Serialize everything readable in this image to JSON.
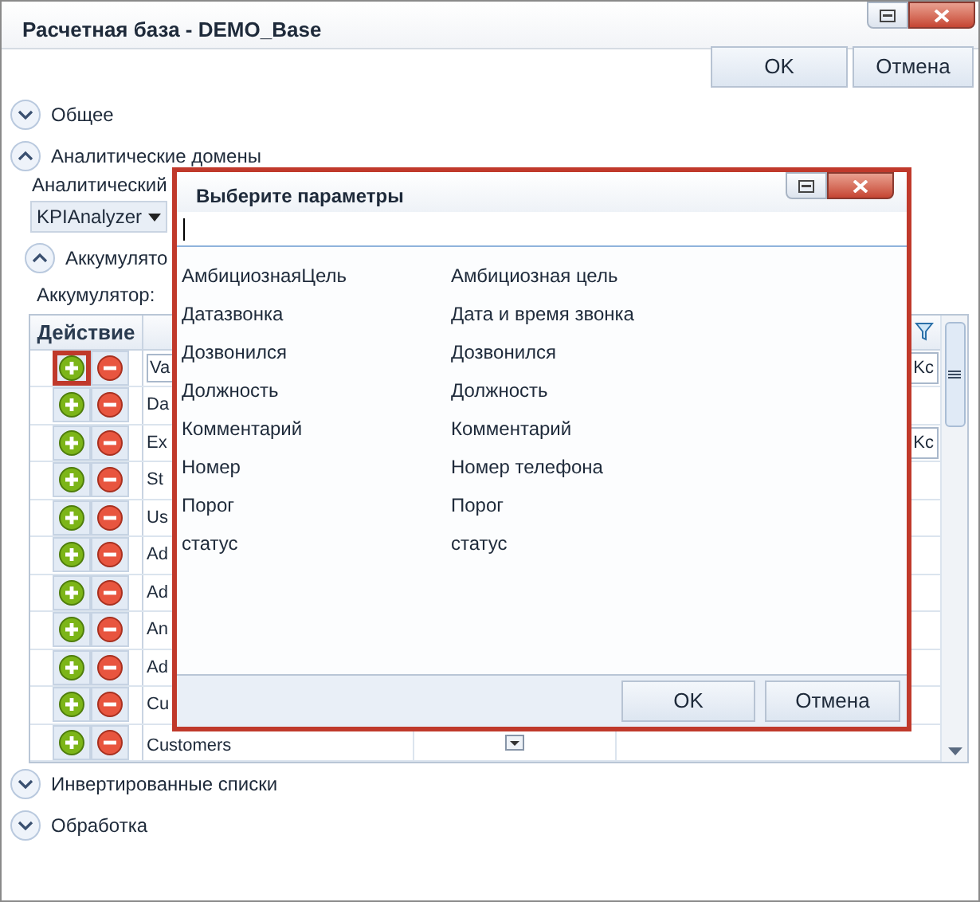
{
  "window": {
    "title": "Расчетная база - DEMO_Base"
  },
  "buttons": [
    "OK",
    "Отмена"
  ],
  "sections": [
    {
      "label": "Общее",
      "expanded": false
    },
    {
      "label": "Аналитические домены",
      "expanded": true,
      "domain_label": "Аналитический",
      "domain_value": "KPIAnalyzer",
      "subsection": {
        "label": "Аккумулято",
        "expanded": true,
        "field_label": "Аккумулятор:",
        "table": {
          "action_header": "Действие",
          "rows": [
            {
              "kind": "filter",
              "name": "Va",
              "extra": "Kc",
              "highlighted": true
            },
            {
              "kind": "plain",
              "name": "Da",
              "highlighted": false
            },
            {
              "kind": "plain",
              "name": "Ex",
              "extra": "Kc",
              "highlighted": false
            },
            {
              "kind": "plain",
              "name": "St",
              "highlighted": false
            },
            {
              "kind": "plain",
              "name": "Us",
              "highlighted": false
            },
            {
              "kind": "plain",
              "name": "Ad",
              "highlighted": false
            },
            {
              "kind": "plain",
              "name": "Ad",
              "highlighted": false
            },
            {
              "kind": "plain",
              "name": "An",
              "highlighted": false
            },
            {
              "kind": "plain",
              "name": "Ad",
              "highlighted": false
            },
            {
              "kind": "plain",
              "name": "Cu",
              "highlighted": false
            },
            {
              "kind": "picker",
              "name": "Customers",
              "highlighted": false
            }
          ]
        }
      }
    },
    {
      "label": "Инвертированные списки",
      "expanded": false
    },
    {
      "label": "Обработка",
      "expanded": false
    }
  ],
  "dialog": {
    "title": "Выберите параметры",
    "items": [
      {
        "name": "АмбициознаяЦель",
        "caption": "Амбициозная цель"
      },
      {
        "name": "Датазвонка",
        "caption": "Дата и время звонка"
      },
      {
        "name": "Дозвонился",
        "caption": "Дозвонился"
      },
      {
        "name": "Должность",
        "caption": "Должность"
      },
      {
        "name": "Комментарий",
        "caption": "Комментарий"
      },
      {
        "name": "Номер",
        "caption": "Номер телефона"
      },
      {
        "name": "Порог",
        "caption": "Порог"
      },
      {
        "name": "статус",
        "caption": "статус"
      }
    ],
    "buttons": [
      "OK",
      "Отмена"
    ]
  }
}
